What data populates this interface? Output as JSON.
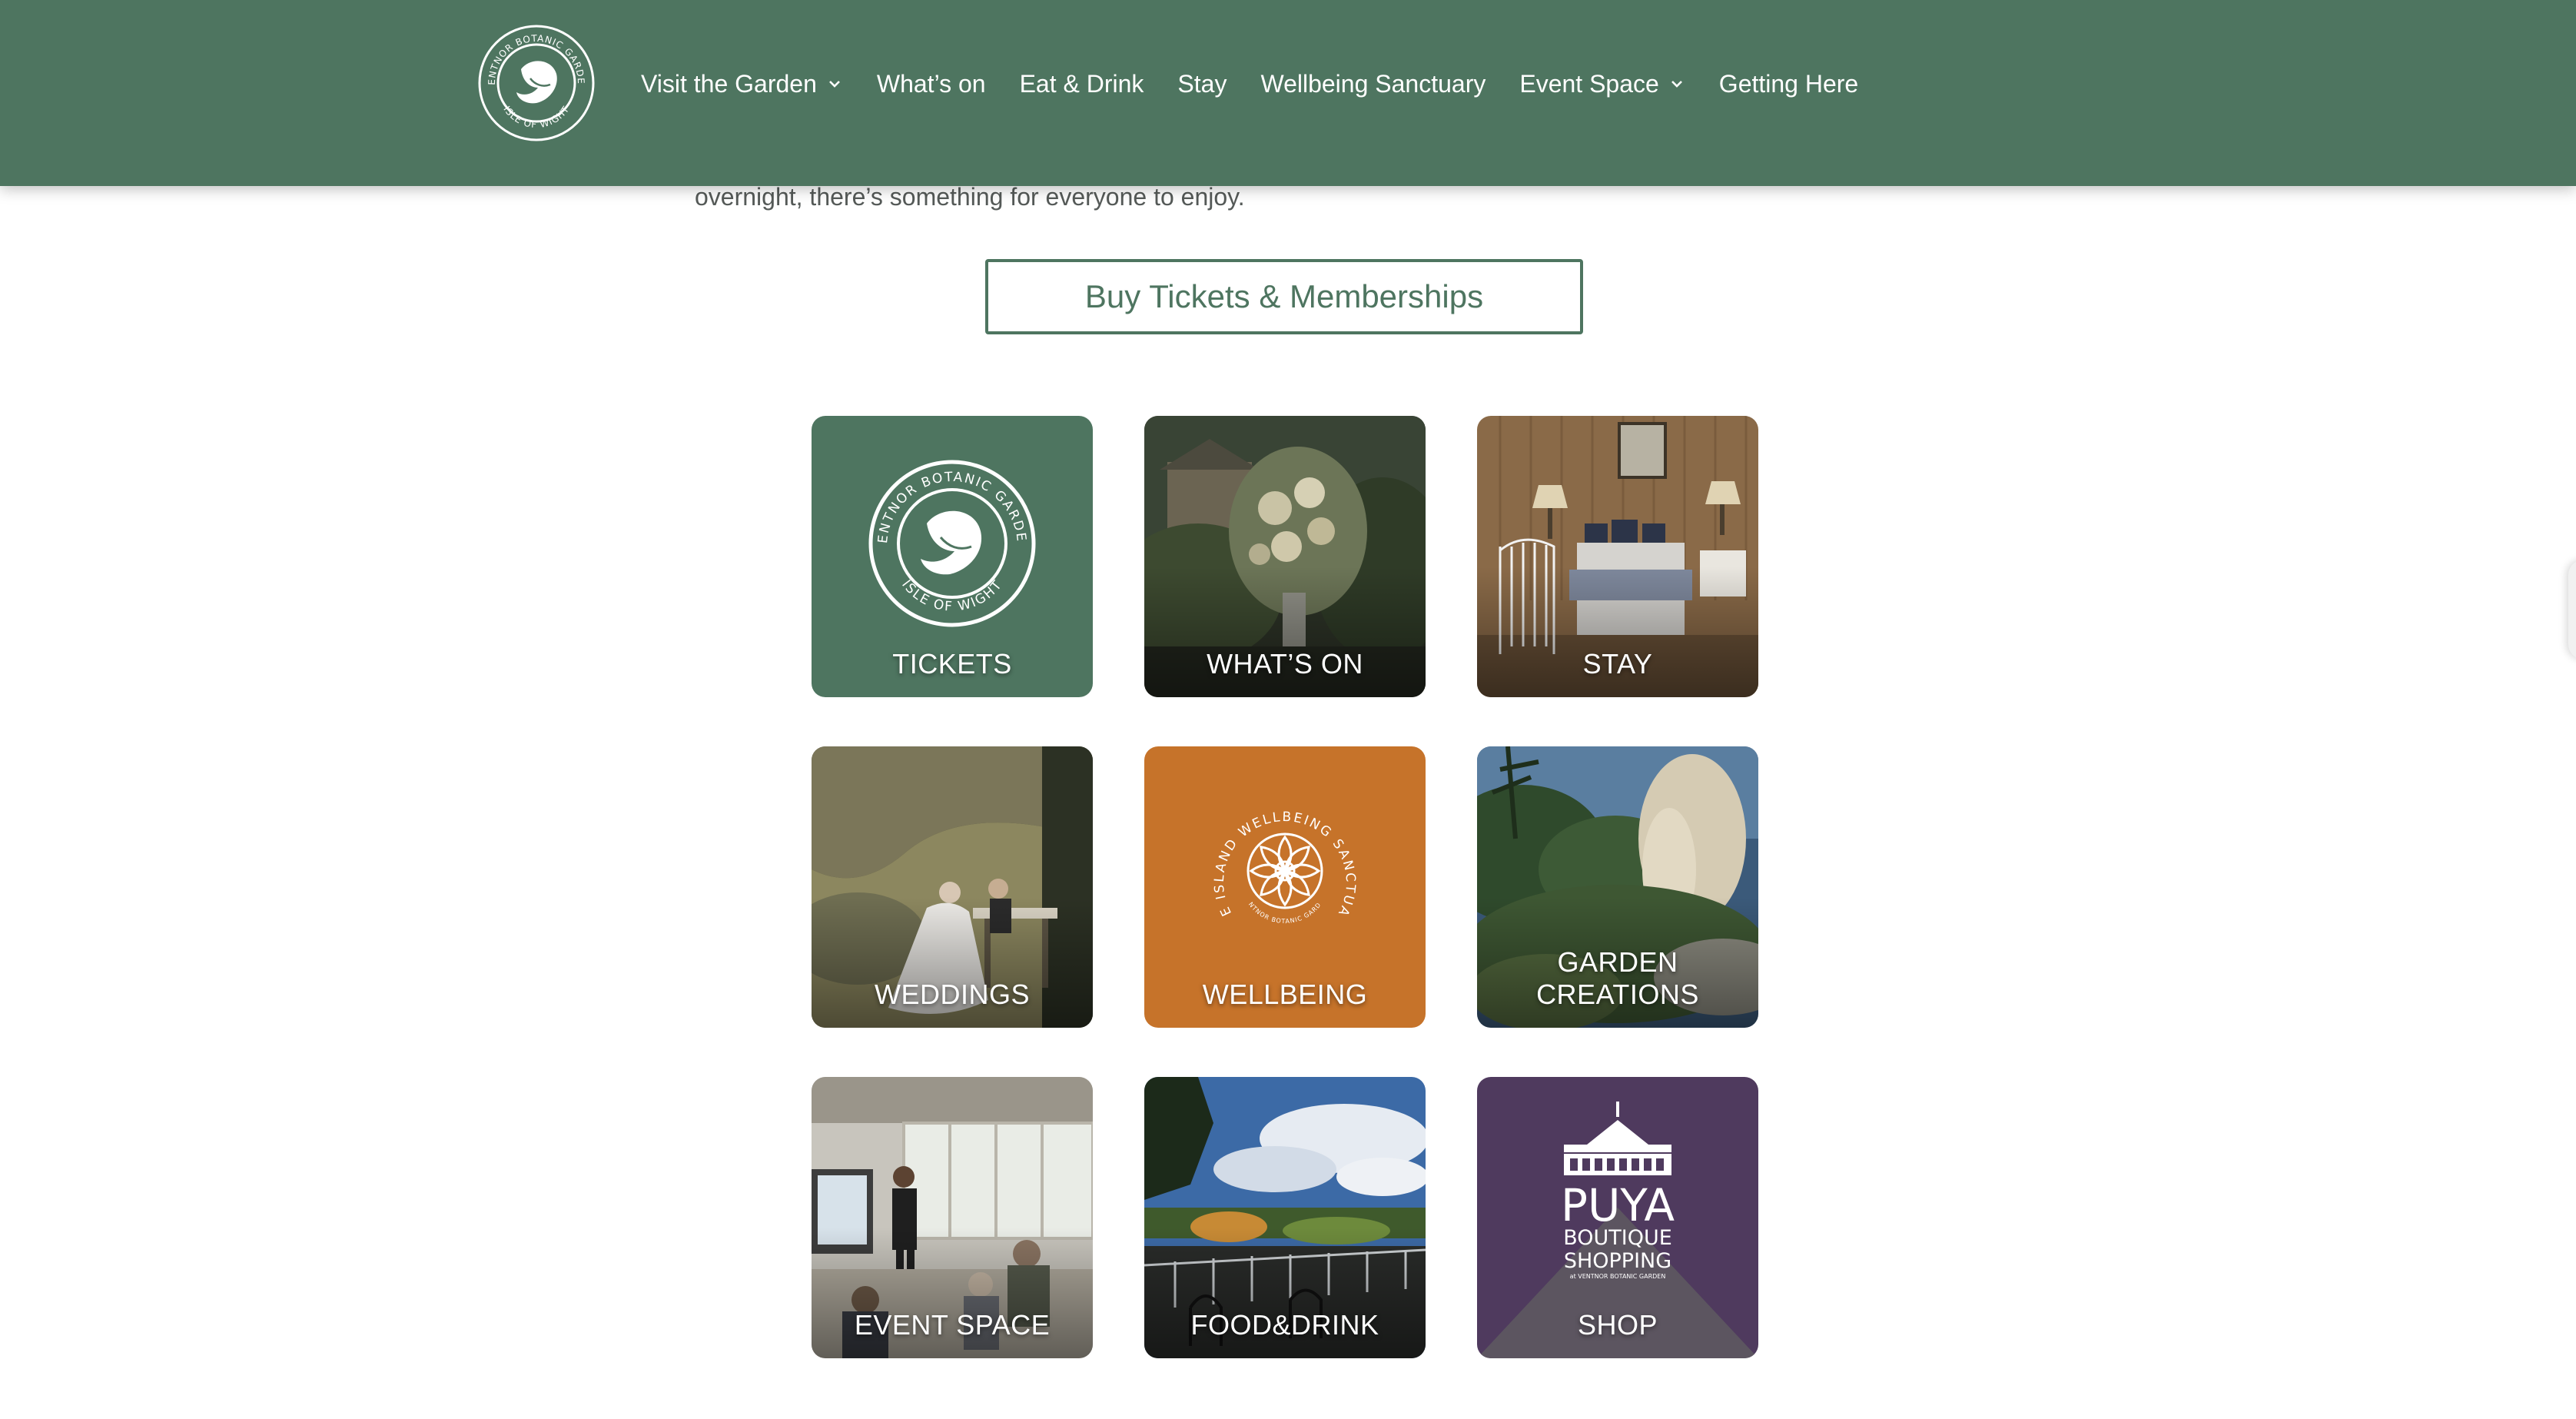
{
  "header": {
    "logo_text": "VENTNOR BOTANIC GARDEN · ISLE OF WIGHT",
    "nav": [
      {
        "label": "Visit the Garden",
        "dropdown": true
      },
      {
        "label": "What’s on",
        "dropdown": false
      },
      {
        "label": "Eat & Drink",
        "dropdown": false
      },
      {
        "label": "Stay",
        "dropdown": false
      },
      {
        "label": "Wellbeing Sanctuary",
        "dropdown": false
      },
      {
        "label": "Event Space",
        "dropdown": true
      },
      {
        "label": "Getting Here",
        "dropdown": false
      }
    ]
  },
  "main": {
    "intro_text": "overnight, there’s something for everyone to enjoy.",
    "cta_label": "Buy Tickets & Memberships"
  },
  "tiles": [
    {
      "label": "TICKETS",
      "style": "logo",
      "color": "#4e7560"
    },
    {
      "label": "WHAT’S ON",
      "style": "photo-flowers"
    },
    {
      "label": "STAY",
      "style": "photo-bedroom"
    },
    {
      "label": "WEDDINGS",
      "style": "photo-wedding"
    },
    {
      "label": "WELLBEING",
      "style": "mandala",
      "color": "#c6732a"
    },
    {
      "label": "GARDEN CREATIONS",
      "style": "photo-garden"
    },
    {
      "label": "EVENT SPACE",
      "style": "photo-event"
    },
    {
      "label": "FOOD&DRINK",
      "style": "photo-terrace"
    },
    {
      "label": "SHOP",
      "style": "shop",
      "color": "#4f3a5e"
    }
  ],
  "wellbeing_logo": {
    "ring_text": "THE ISLAND WELLBEING SANCTUARY",
    "sub_text": "VENTNOR BOTANIC GARDEN"
  },
  "shop_logo": {
    "title": "PUYA",
    "line1": "BOUTIQUE",
    "line2": "SHOPPING",
    "sub": "at VENTNOR BOTANIC GARDEN"
  },
  "colors": {
    "header_bg": "#4e7560",
    "accent_green": "#4e7560",
    "wellbeing_orange": "#c6732a",
    "shop_purple": "#4f3a5e"
  }
}
